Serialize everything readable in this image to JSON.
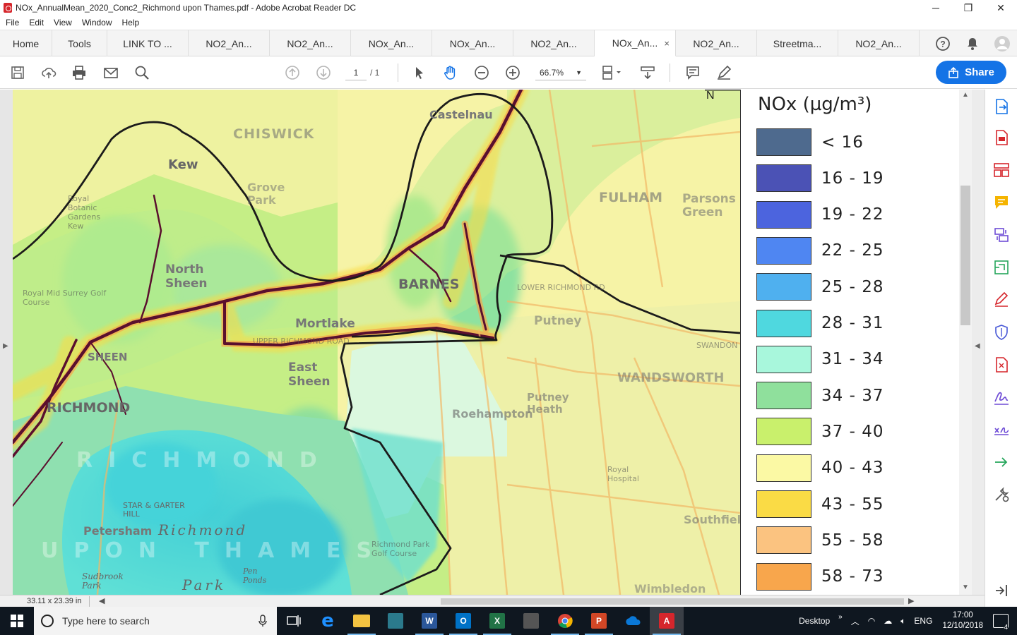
{
  "window": {
    "title": "NOx_AnnualMean_2020_Conc2_Richmond upon Thames.pdf - Adobe Acrobat Reader DC",
    "minimize": "─",
    "maximize": "❐",
    "close": "✕"
  },
  "menu": [
    "File",
    "Edit",
    "View",
    "Window",
    "Help"
  ],
  "tabs": [
    {
      "label": "Home",
      "active": false
    },
    {
      "label": "Tools",
      "active": false
    },
    {
      "label": "LINK TO ...",
      "active": false
    },
    {
      "label": "NO2_An...",
      "active": false
    },
    {
      "label": "NO2_An...",
      "active": false
    },
    {
      "label": "NOx_An...",
      "active": false
    },
    {
      "label": "NOx_An...",
      "active": false
    },
    {
      "label": "NO2_An...",
      "active": false
    },
    {
      "label": "NOx_An...",
      "active": true
    },
    {
      "label": "NO2_An...",
      "active": false
    },
    {
      "label": "Streetma...",
      "active": false
    },
    {
      "label": "NO2_An...",
      "active": false
    }
  ],
  "tab_close": "×",
  "toolbar": {
    "page_current": "1",
    "page_total": "/ 1",
    "zoom": "66.7%",
    "share_label": "Share",
    "icons": [
      "save-icon",
      "upload-icon",
      "print-icon",
      "email-icon",
      "search-icon",
      "page-up-icon",
      "page-down-icon",
      "select-arrow-icon",
      "hand-icon",
      "zoom-out-icon",
      "zoom-in-icon",
      "fit-page-icon",
      "scroll-mode-icon",
      "comment-icon",
      "sign-icon"
    ]
  },
  "map": {
    "labels": [
      {
        "text": "Kew",
        "cls": "big"
      },
      {
        "text": "CHISWICK",
        "cls": "big"
      },
      {
        "text": "Grove Park",
        "cls": "mid"
      },
      {
        "text": "Castelnau",
        "cls": "big"
      },
      {
        "text": "North Sheen",
        "cls": "big"
      },
      {
        "text": "BARNES",
        "cls": "big"
      },
      {
        "text": "Mortlake",
        "cls": "big"
      },
      {
        "text": "FULHAM",
        "cls": "big"
      },
      {
        "text": "Parsons Green",
        "cls": "mid"
      },
      {
        "text": "Putney",
        "cls": "big"
      },
      {
        "text": "East Sheen",
        "cls": "big"
      },
      {
        "text": "RICHMOND",
        "cls": "big"
      },
      {
        "text": "SHEEN",
        "cls": "mid"
      },
      {
        "text": "Roehampton",
        "cls": "mid"
      },
      {
        "text": "Putney Heath",
        "cls": "mid"
      },
      {
        "text": "WANDSWORTH",
        "cls": "big"
      },
      {
        "text": "Petersham",
        "cls": "mid"
      },
      {
        "text": "Richmond",
        "cls": "ital"
      },
      {
        "text": "Park",
        "cls": "ital"
      },
      {
        "text": "RICHMOND",
        "cls": "ghost"
      },
      {
        "text": "UPON THAMES",
        "cls": "ghost"
      },
      {
        "text": "Southfield",
        "cls": "mid"
      },
      {
        "text": "Wimbledon",
        "cls": "mid"
      },
      {
        "text": "STAR & GARTER HILL",
        "cls": "small"
      },
      {
        "text": "Royal Botanic Gardens Kew",
        "cls": "small"
      },
      {
        "text": "Royal Mid Surrey Golf Course",
        "cls": "small"
      },
      {
        "text": "LOWER RICHMOND RD",
        "cls": "small"
      },
      {
        "text": "UPPER RICHMOND ROAD",
        "cls": "small"
      },
      {
        "text": "SWANDON",
        "cls": "small"
      },
      {
        "text": "Richmond Park Golf Course",
        "cls": "small"
      },
      {
        "text": "Pen Ponds",
        "cls": "small"
      },
      {
        "text": "Sudbrook Park",
        "cls": "small"
      },
      {
        "text": "Royal Hospital",
        "cls": "small"
      },
      {
        "text": "N",
        "cls": "mid"
      }
    ]
  },
  "legend": {
    "title": "NOx (µg/m³)",
    "items": [
      {
        "label": "< 16",
        "color": "#4e6a8e"
      },
      {
        "label": "16 - 19",
        "color": "#4b52b5"
      },
      {
        "label": "19 - 22",
        "color": "#4c64de"
      },
      {
        "label": "22 - 25",
        "color": "#4f86f2"
      },
      {
        "label": "25 - 28",
        "color": "#4fb0ef"
      },
      {
        "label": "28 - 31",
        "color": "#4fd8df"
      },
      {
        "label": "31 - 34",
        "color": "#a8f7dc"
      },
      {
        "label": "34 - 37",
        "color": "#8fe09c"
      },
      {
        "label": "37 - 40",
        "color": "#c9f06c"
      },
      {
        "label": "40 - 43",
        "color": "#fbf9a4"
      },
      {
        "label": "43 - 55",
        "color": "#fadb45"
      },
      {
        "label": "55 - 58",
        "color": "#fbc380"
      },
      {
        "label": "58 - 73",
        "color": "#f8a64c"
      }
    ]
  },
  "status": {
    "page_size": "33.11 x 23.39 in"
  },
  "right_tools": [
    "export-pdf-icon",
    "create-pdf-icon",
    "organize-pages-icon",
    "comment-tool-icon",
    "combine-files-icon",
    "edit-pdf-icon",
    "fill-sign-icon",
    "protect-icon",
    "compress-icon",
    "send-sign-icon",
    "certificates-icon",
    "send-track-icon",
    "more-tools-icon",
    "collapse-panel-icon"
  ],
  "taskbar": {
    "search_placeholder": "Type here to search",
    "desktop_label": "Desktop",
    "lang": "ENG",
    "time": "17:00",
    "date": "12/10/2018",
    "notif": "4"
  },
  "colors": {
    "accent": "#1473e6",
    "road": "#5a0f2e",
    "boundary": "#1b1b1b"
  }
}
